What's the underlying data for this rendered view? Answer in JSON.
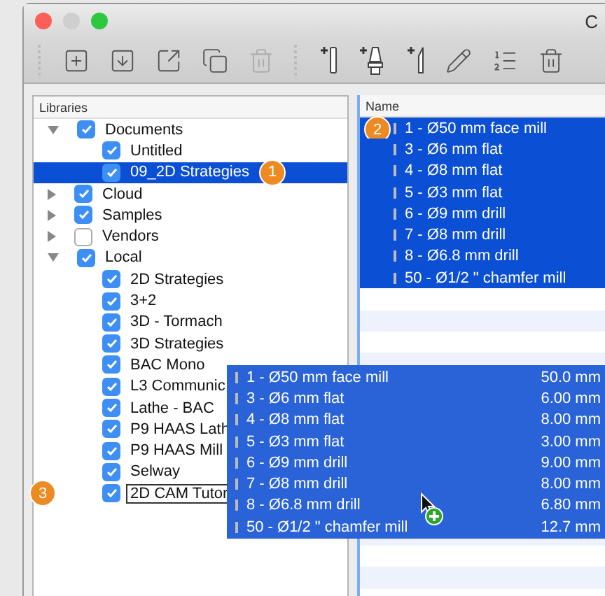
{
  "window": {
    "title": "C"
  },
  "libraries": {
    "header": "Libraries",
    "tree": [
      {
        "label": "Documents",
        "checked": true,
        "expanded": true,
        "selected": false,
        "children": [
          {
            "label": "Untitled",
            "checked": true,
            "selected": false
          },
          {
            "label": "09_2D Strategies",
            "checked": true,
            "selected": true,
            "badge": "1"
          }
        ]
      },
      {
        "label": "Cloud",
        "checked": true,
        "expanded": false,
        "selected": false
      },
      {
        "label": "Samples",
        "checked": true,
        "expanded": false,
        "selected": false
      },
      {
        "label": "Vendors",
        "checked": false,
        "expanded": false,
        "selected": false
      },
      {
        "label": "Local",
        "checked": true,
        "expanded": true,
        "selected": false,
        "children": [
          {
            "label": "2D Strategies",
            "checked": true,
            "selected": false
          },
          {
            "label": "3+2",
            "checked": true,
            "selected": false
          },
          {
            "label": "3D - Tormach",
            "checked": true,
            "selected": false
          },
          {
            "label": "3D Strategies",
            "checked": true,
            "selected": false
          },
          {
            "label": "BAC Mono",
            "checked": true,
            "selected": false
          },
          {
            "label": "L3 Communic",
            "checked": true,
            "selected": false
          },
          {
            "label": "Lathe - BAC",
            "checked": true,
            "selected": false
          },
          {
            "label": "P9 HAAS Lath",
            "checked": true,
            "selected": false
          },
          {
            "label": "P9 HAAS Mill",
            "checked": true,
            "selected": false
          },
          {
            "label": "Selway",
            "checked": true,
            "selected": false
          },
          {
            "label": "2D CAM Tutor",
            "checked": true,
            "selected": false,
            "drop_target": true,
            "badge": "3"
          }
        ]
      }
    ]
  },
  "tools": {
    "columns": [
      "Name"
    ],
    "rows": [
      {
        "name": "1 - Ø50 mm face mill",
        "selected": true,
        "badge": "2"
      },
      {
        "name": "3 - Ø6 mm flat",
        "selected": true
      },
      {
        "name": "4 - Ø8 mm flat",
        "selected": true
      },
      {
        "name": "5 - Ø3 mm flat",
        "selected": true
      },
      {
        "name": "6 - Ø9 mm drill",
        "selected": true
      },
      {
        "name": "7 - Ø8 mm drill",
        "selected": true
      },
      {
        "name": "8 - Ø6.8 mm drill",
        "selected": true
      },
      {
        "name": "50 - Ø1/2 \" chamfer mill",
        "selected": true
      }
    ]
  },
  "drag": {
    "rows": [
      {
        "name": "1 - Ø50 mm face mill",
        "diameter": "50.0 mm"
      },
      {
        "name": "3 - Ø6 mm flat",
        "diameter": "6.00 mm"
      },
      {
        "name": "4 - Ø8 mm flat",
        "diameter": "8.00 mm"
      },
      {
        "name": "5 - Ø3 mm flat",
        "diameter": "3.00 mm"
      },
      {
        "name": "6 - Ø9 mm drill",
        "diameter": "9.00 mm"
      },
      {
        "name": "7 - Ø8 mm drill",
        "diameter": "8.00 mm"
      },
      {
        "name": "8 - Ø6.8 mm drill",
        "diameter": "6.80 mm"
      },
      {
        "name": "50 - Ø1/2 \" chamfer mill",
        "diameter": "12.7 mm"
      }
    ]
  }
}
